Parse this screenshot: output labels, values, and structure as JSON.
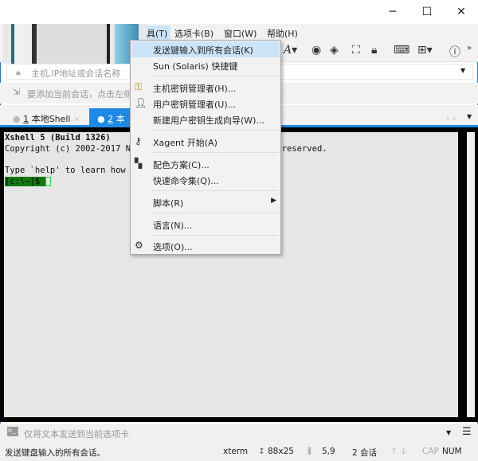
{
  "window": {
    "controls": {
      "minimize": "─",
      "maximize": "☐",
      "close": "✕"
    }
  },
  "menubar": {
    "items": [
      "具(T)",
      "选项卡(B)",
      "窗口(W)",
      "帮助(H)"
    ]
  },
  "toolbar": {
    "icons": [
      "font-icon",
      "xagent-icon",
      "xftp-icon",
      "fullscreen-icon",
      "lock-icon",
      "keyboard-icon",
      "new-tab-icon",
      "help-icon",
      "more-icon"
    ]
  },
  "address": {
    "placeholder": "主机,IP地址或会话名称"
  },
  "session_hint": "要添加当前会话，点击左侧",
  "tabs": [
    {
      "num": "1",
      "label": "本地Shell",
      "active": false
    },
    {
      "num": "2",
      "label": "本地",
      "active": true
    }
  ],
  "terminal": {
    "lines": [
      "Xshell 5 (Build 1326)",
      "Copyright (c) 2002-2017 N",
      "",
      "Type `help' to learn how"
    ],
    "line2_right": "ights reserved.",
    "prompt": "[c:\\~]$ "
  },
  "dropdown": {
    "items": [
      {
        "label": "发送键输入到所有会话(K)",
        "highlighted": true
      },
      {
        "label": "Sun (Solaris) 快捷键"
      },
      {
        "label": "主机密钥管理者(H)...",
        "icon": "host-key-icon"
      },
      {
        "label": "用户密钥管理者(U)...",
        "icon": "user-key-icon"
      },
      {
        "label": "新建用户密钥生成向导(W)..."
      },
      {
        "label": "Xagent 开始(A)",
        "icon": "xagent-icon"
      },
      {
        "label": "配色方案(C)...",
        "icon": "color-scheme-icon"
      },
      {
        "label": "快速命令集(Q)..."
      },
      {
        "label": "脚本(R)",
        "submenu": true
      },
      {
        "label": "语言(N)..."
      },
      {
        "label": "选项(O)...",
        "icon": "gear-icon"
      }
    ]
  },
  "compose": {
    "placeholder": "仅将文本发送到当前选项卡"
  },
  "status": {
    "message": "发送键盘输入的所有会话。",
    "terminal_type": "xterm",
    "size": "88x25",
    "cursor": "5,9",
    "sessions": "2 会话",
    "caps": "CAP",
    "num": "NUM"
  },
  "colors": {
    "accent": "#1e88e5",
    "highlight": "#cce4f7",
    "prompt_bg": "#127a12"
  }
}
